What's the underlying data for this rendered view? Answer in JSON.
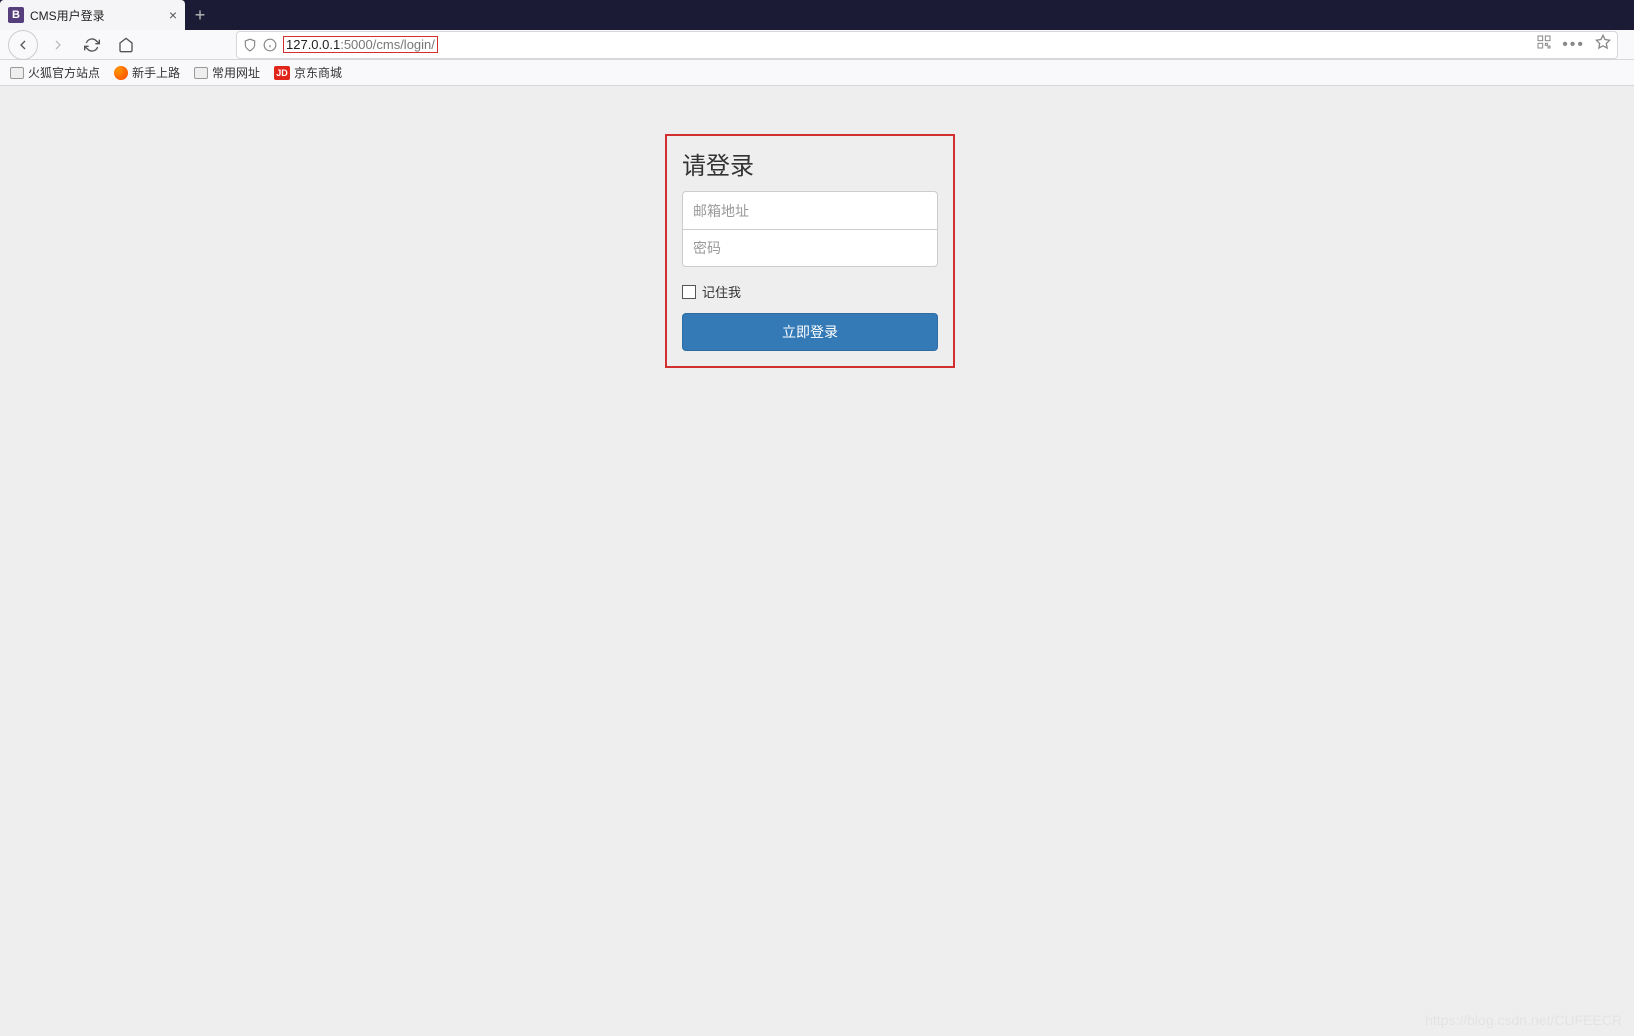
{
  "tab": {
    "title": "CMS用户登录",
    "favicon_letter": "B"
  },
  "url": {
    "host": "127.0.0.1",
    "rest": ":5000/cms/login/"
  },
  "bookmarks": [
    {
      "label": "火狐官方站点",
      "type": "folder"
    },
    {
      "label": "新手上路",
      "type": "firefox"
    },
    {
      "label": "常用网址",
      "type": "folder"
    },
    {
      "label": "京东商城",
      "type": "jd",
      "badge": "JD"
    }
  ],
  "login": {
    "title": "请登录",
    "email_placeholder": "邮箱地址",
    "password_placeholder": "密码",
    "remember_label": "记住我",
    "submit_label": "立即登录"
  },
  "watermark": "https://blog.csdn.net/CUFEECR"
}
